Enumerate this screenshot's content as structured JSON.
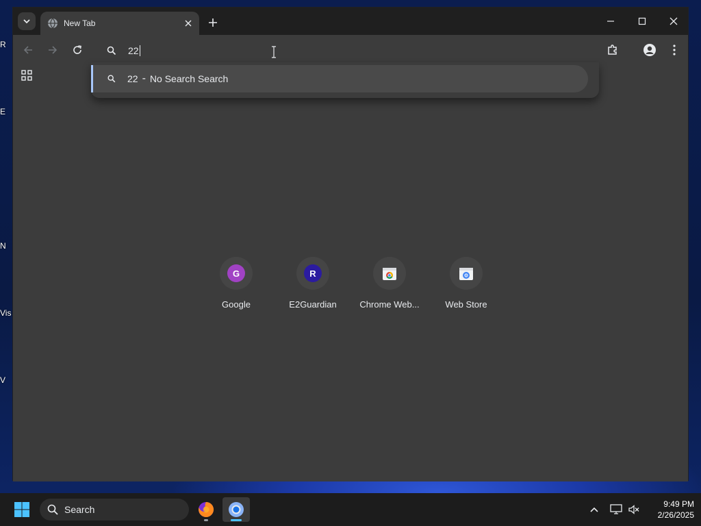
{
  "desktop": {
    "icon_letters": [
      "R",
      "E",
      "N",
      "Vis",
      "V"
    ]
  },
  "browser": {
    "tab": {
      "title": "New Tab"
    },
    "omnibox": {
      "value": "22"
    },
    "suggestion": {
      "query": "22",
      "separator": "-",
      "description": "No Search Search"
    },
    "shortcuts": [
      {
        "label": "Google",
        "letter": "G",
        "color": "#a142c4",
        "icon": "letter-avatar"
      },
      {
        "label": "E2Guardian",
        "letter": "R",
        "color": "#2b1ba0",
        "icon": "letter-avatar"
      },
      {
        "label": "Chrome Web...",
        "letter": "",
        "color": "#ffffff",
        "icon": "chrome-web-store-icon"
      },
      {
        "label": "Web Store",
        "letter": "",
        "color": "#ffffff",
        "icon": "web-store-icon"
      }
    ]
  },
  "taskbar": {
    "search_label": "Search",
    "time": "9:49 PM",
    "date": "2/26/2025"
  },
  "colors": {
    "accent": "#a8c7fa",
    "window_bg": "#3c3c3c",
    "tabstrip_bg": "#1f1f1f"
  }
}
